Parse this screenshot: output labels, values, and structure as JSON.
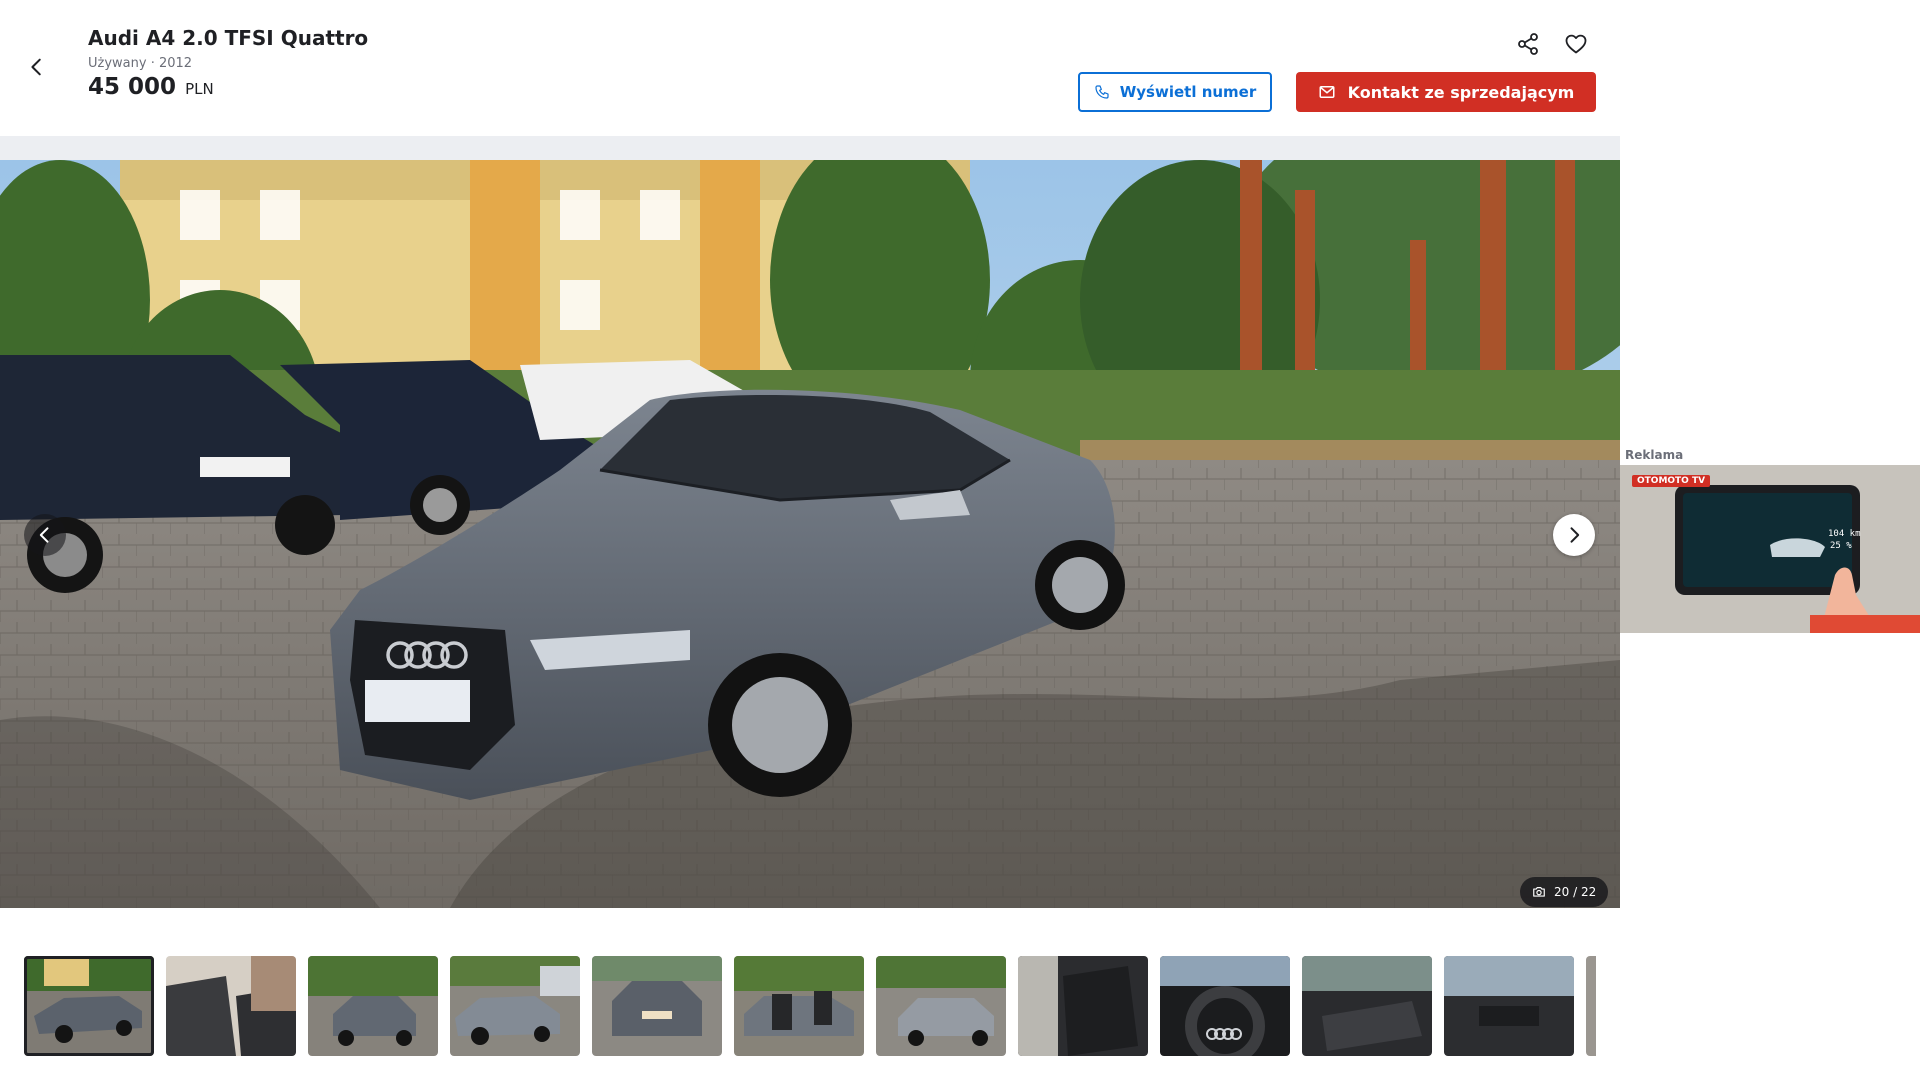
{
  "listing": {
    "title": "Audi A4 2.0 TFSI Quattro",
    "subtitle": "Używany · 2012",
    "price": "45 000",
    "currency": "PLN"
  },
  "actions": {
    "phone_label": "Wyświetl numer",
    "contact_label": "Kontakt ze sprzedającym"
  },
  "icons": {
    "back": "arrow-left-icon",
    "share": "share-icon",
    "favorite": "heart-icon",
    "phone": "phone-icon",
    "mail": "mail-icon",
    "camera": "camera-icon",
    "prev": "chevron-left-icon",
    "next": "chevron-right-icon"
  },
  "gallery": {
    "counter": "20 / 22",
    "current": 20,
    "total": 22
  },
  "thumbnails": [
    {
      "id": 1,
      "subject": "car-front-left",
      "active": true
    },
    {
      "id": 2,
      "subject": "rear-seats"
    },
    {
      "id": 3,
      "subject": "car-front"
    },
    {
      "id": 4,
      "subject": "car-side"
    },
    {
      "id": 5,
      "subject": "car-rear"
    },
    {
      "id": 6,
      "subject": "open-doors"
    },
    {
      "id": 7,
      "subject": "car-rear-right"
    },
    {
      "id": 8,
      "subject": "interior-door"
    },
    {
      "id": 9,
      "subject": "steering-wheel"
    },
    {
      "id": 10,
      "subject": "gear-shifter"
    },
    {
      "id": 11,
      "subject": "dashboard"
    },
    {
      "id": 12,
      "subject": "partial"
    }
  ],
  "ad": {
    "label": "Reklama",
    "logo": "OTOMOTO TV",
    "screen_value_1": "104 km",
    "screen_value_2": "25 %"
  },
  "colors": {
    "primary_blue": "#0b6fd6",
    "primary_red": "#d12f24",
    "text": "#1f2024",
    "muted": "#6b6e78",
    "gallery_bg": "#eceef2"
  }
}
